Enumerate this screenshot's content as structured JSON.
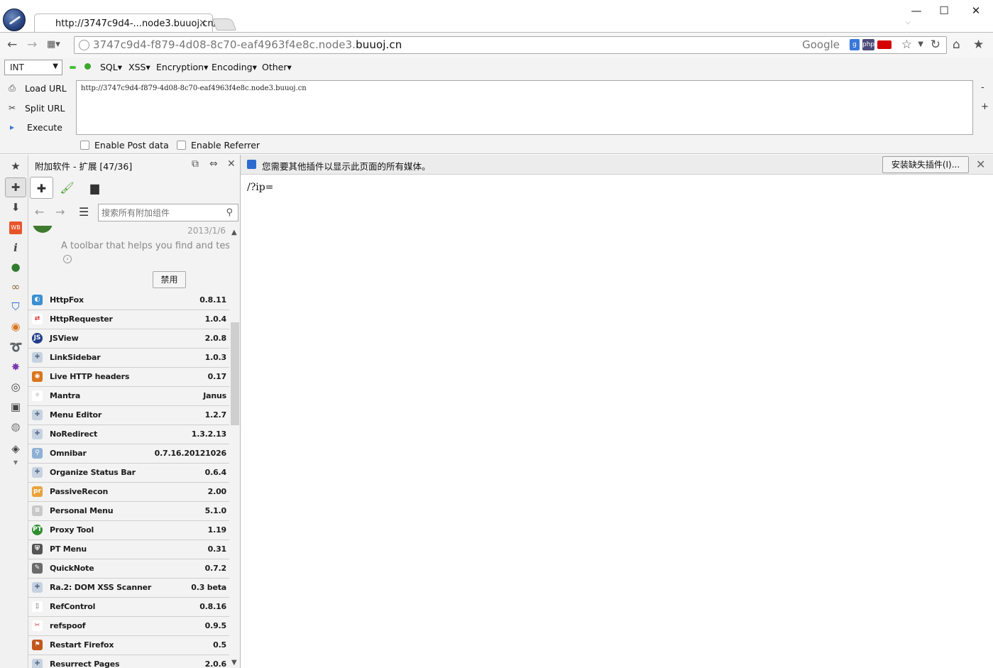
{
  "tab": {
    "title": "http://3747c9d4-...node3.buuoj.cn/",
    "close": "×"
  },
  "window": {
    "minimize": "—",
    "maximize": "☐",
    "close": "✕"
  },
  "navbar": {
    "url_prefix": "3747c9d4-f879-4d08-8c70-eaf4963f4e8c.node3.",
    "url_domain": "buuoj.cn",
    "search_engine": "Google",
    "php_badge": "php"
  },
  "hackbar": {
    "select_value": "INT",
    "menus": [
      "SQL",
      "XSS",
      "Encryption",
      "Encoding",
      "Other"
    ],
    "load_url": "Load URL",
    "split_url": "Split URL",
    "execute": "Execute",
    "url_value": "http://3747c9d4-f879-4d08-8c70-eaf4963f4e8c.node3.buuoj.cn",
    "enable_post": "Enable Post data",
    "enable_referrer": "Enable Referrer",
    "minus": "-",
    "plus": "+"
  },
  "addons": {
    "panel_title": "附加软件 - 扩展 [47/36]",
    "search_placeholder": "搜索所有附加组件",
    "expanded": {
      "date": "2013/1/6",
      "description": "A toolbar that helps you find and tes...",
      "disable_label": "禁用"
    },
    "items": [
      {
        "name": "HttpFox",
        "version": "0.8.11",
        "icon": "httpfox-icon",
        "color": "#3b8fd1"
      },
      {
        "name": "HttpRequester",
        "version": "1.0.4",
        "icon": "arrows-icon",
        "color": "#ffffff"
      },
      {
        "name": "JSView",
        "version": "2.0.8",
        "icon": "jsview-icon",
        "color": "#1e3d8a"
      },
      {
        "name": "LinkSidebar",
        "version": "1.0.3",
        "icon": "puzzle-icon",
        "color": "#c6d2e0"
      },
      {
        "name": "Live HTTP headers",
        "version": "0.17",
        "icon": "live-http-icon",
        "color": "#d9751c"
      },
      {
        "name": "Mantra",
        "version": "Janus",
        "icon": "mantra-icon",
        "color": "#ffffff"
      },
      {
        "name": "Menu Editor",
        "version": "1.2.7",
        "icon": "puzzle-icon",
        "color": "#c6d2e0"
      },
      {
        "name": "NoRedirect",
        "version": "1.3.2.13",
        "icon": "puzzle-icon",
        "color": "#c6d2e0"
      },
      {
        "name": "Omnibar",
        "version": "0.7.16.20121026",
        "icon": "magnifier-icon",
        "color": "#8fb0d4"
      },
      {
        "name": "Organize Status Bar",
        "version": "0.6.4",
        "icon": "puzzle-icon",
        "color": "#c6d2e0"
      },
      {
        "name": "PassiveRecon",
        "version": "2.00",
        "icon": "pr-icon",
        "color": "#e9a23b"
      },
      {
        "name": "Personal Menu",
        "version": "5.1.0",
        "icon": "menu-icon",
        "color": "#c8c8c8"
      },
      {
        "name": "Proxy Tool",
        "version": "1.19",
        "icon": "pt-icon",
        "color": "#2f8f2f"
      },
      {
        "name": "PT Menu",
        "version": "0.31",
        "icon": "shield-icon",
        "color": "#555555"
      },
      {
        "name": "QuickNote",
        "version": "0.7.2",
        "icon": "note-icon",
        "color": "#6b6b6b"
      },
      {
        "name": "Ra.2: DOM XSS Scanner",
        "version": "0.3 beta",
        "icon": "puzzle-icon",
        "color": "#c6d2e0"
      },
      {
        "name": "RefControl",
        "version": "0.8.16",
        "icon": "page-icon",
        "color": "#ffffff"
      },
      {
        "name": "refspoof",
        "version": "0.9.5",
        "icon": "refspoof-icon",
        "color": "#ffffff"
      },
      {
        "name": "Restart Firefox",
        "version": "0.5",
        "icon": "restart-icon",
        "color": "#c2571e"
      },
      {
        "name": "Resurrect Pages",
        "version": "2.0.6",
        "icon": "resurrect-icon",
        "color": "#c6d2e0"
      }
    ]
  },
  "content": {
    "notification": "您需要其他插件以显示此页面的所有媒体。",
    "install_button": "安装缺失插件(I)...",
    "body_text": "/?ip="
  }
}
